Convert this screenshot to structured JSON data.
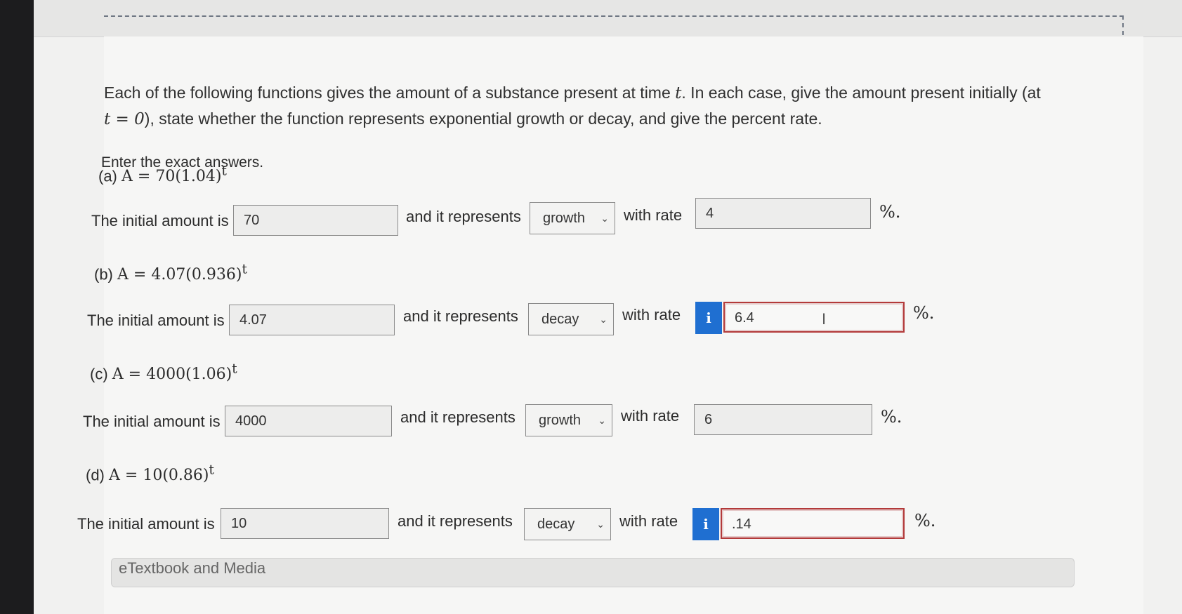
{
  "intro": {
    "line1_pre": "Each of the following functions gives the amount of a substance present at time ",
    "t_var": "t",
    "line1_post": ". In each case, give the amount present initially (at",
    "line2_math": "t = 0",
    "line2_post": "), state whether the function represents exponential growth or decay, and give the percent rate."
  },
  "enter_text": "Enter the exact answers.",
  "labels": {
    "initial": "The initial amount is",
    "represents": "and it represents",
    "rate": "with rate",
    "percent": "%."
  },
  "parts": [
    {
      "label": "(a)",
      "equation": "A = 70(1.04)",
      "exponent": "t",
      "initial": "70",
      "type": "growth",
      "rate": "4",
      "flagged": false
    },
    {
      "label": "(b)",
      "equation": "A = 4.07(0.936)",
      "exponent": "t",
      "initial": "4.07",
      "type": "decay",
      "rate": "6.4",
      "flagged": true
    },
    {
      "label": "(c)",
      "equation": "A = 4000(1.06)",
      "exponent": "t",
      "initial": "4000",
      "type": "growth",
      "rate": "6",
      "flagged": false
    },
    {
      "label": "(d)",
      "equation": "A = 10(0.86)",
      "exponent": "t",
      "initial": "10",
      "type": "decay",
      "rate": ".14",
      "flagged": true
    }
  ],
  "info_glyph": "i",
  "chevron_glyph": "⌄",
  "cursor_glyph": "I",
  "etextbook_label": "eTextbook and Media",
  "colors": {
    "info_blue": "#1f6fd1",
    "error_red": "#b33a3a"
  }
}
